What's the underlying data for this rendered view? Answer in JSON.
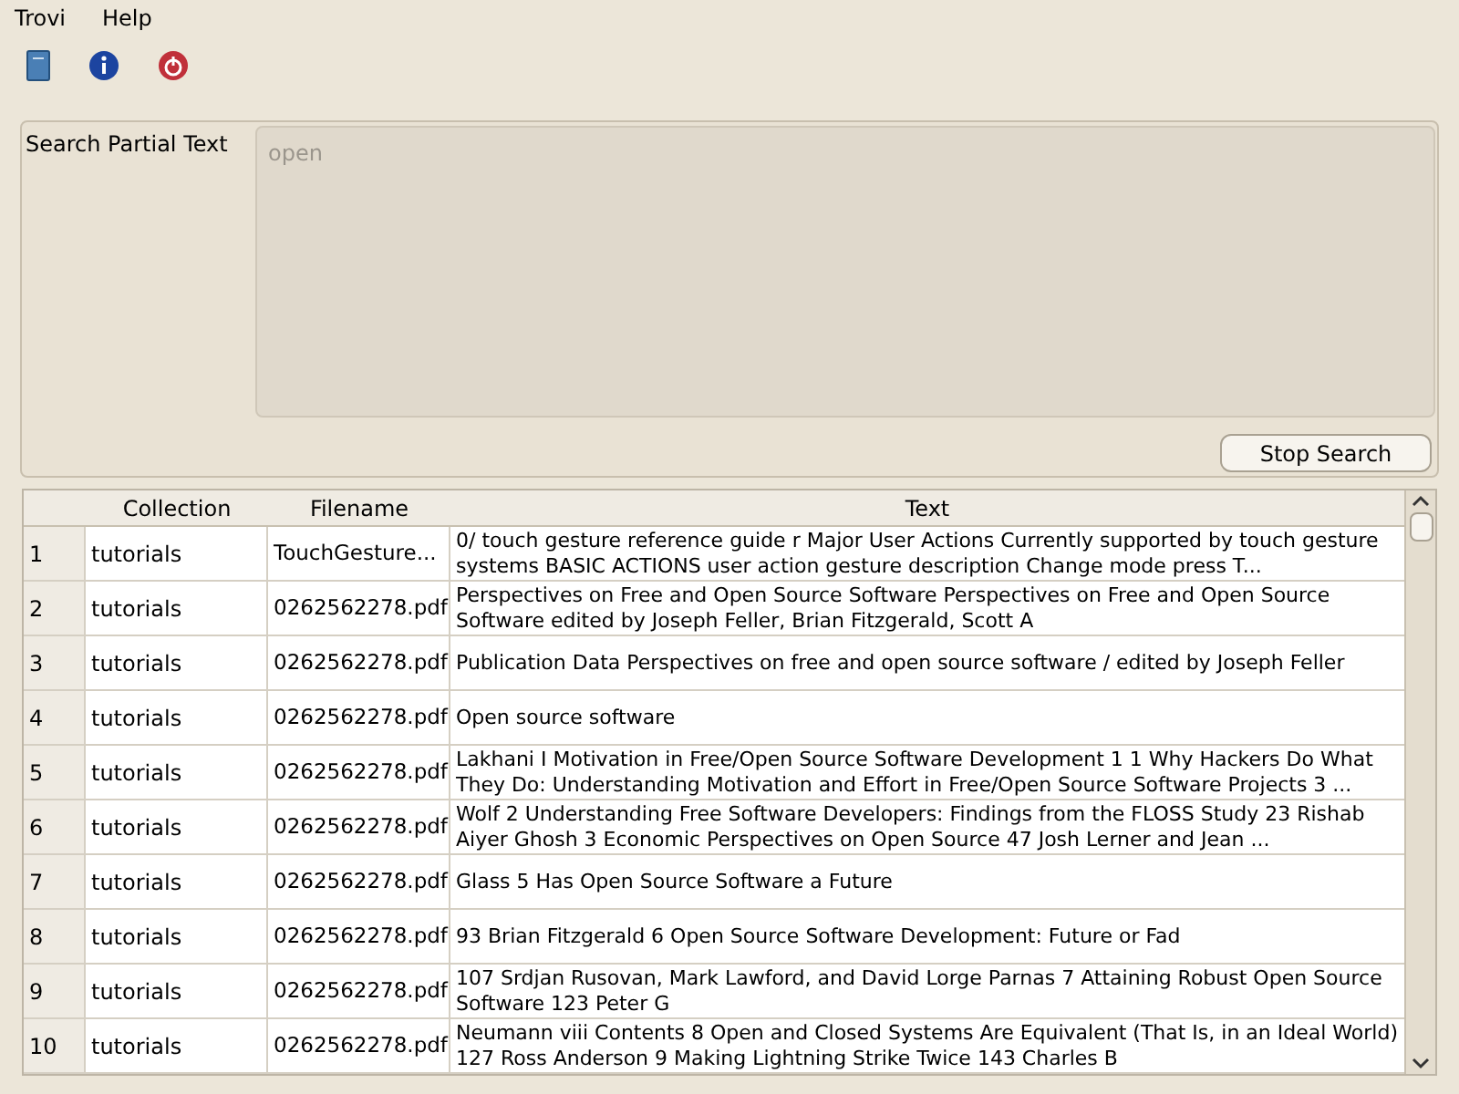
{
  "menu": [
    "Trovi",
    "Help"
  ],
  "search": {
    "label": "Search Partial Text",
    "value": "open",
    "disabled": true,
    "button": "Stop Search"
  },
  "table": {
    "columns": [
      "Collection",
      "Filename",
      "Text"
    ],
    "rows": [
      {
        "index": "1",
        "collection": "tutorials",
        "filename": "TouchGesture...",
        "text": "0/ touch gesture reference guide r Major User Actions Currently supported by touch gesture systems BASIC ACTIONS user action gesture description Change mode press T..."
      },
      {
        "index": "2",
        "collection": "tutorials",
        "filename": "0262562278.pdf",
        "text": "Perspectives on Free and Open Source Software Perspectives on Free and Open Source Software edited by Joseph Feller, Brian Fitzgerald, Scott A"
      },
      {
        "index": "3",
        "collection": "tutorials",
        "filename": "0262562278.pdf",
        "text": "Publication Data Perspectives on free and open source software / edited by Joseph Feller"
      },
      {
        "index": "4",
        "collection": "tutorials",
        "filename": "0262562278.pdf",
        "text": "Open source software"
      },
      {
        "index": "5",
        "collection": "tutorials",
        "filename": "0262562278.pdf",
        "text": "Lakhani I Motivation in Free/Open Source Software Development 1 1 Why Hackers Do What They Do: Understanding Motivation and Effort in Free/Open Source Software Projects 3 ..."
      },
      {
        "index": "6",
        "collection": "tutorials",
        "filename": "0262562278.pdf",
        "text": "Wolf 2 Understanding Free Software Developers: Findings from the FLOSS Study 23 Rishab Aiyer Ghosh 3 Economic Perspectives on Open Source 47 Josh Lerner and Jean ..."
      },
      {
        "index": "7",
        "collection": "tutorials",
        "filename": "0262562278.pdf",
        "text": "Glass 5 Has Open Source Software a Future"
      },
      {
        "index": "8",
        "collection": "tutorials",
        "filename": "0262562278.pdf",
        "text": "93 Brian Fitzgerald 6 Open Source Software Development: Future or Fad"
      },
      {
        "index": "9",
        "collection": "tutorials",
        "filename": "0262562278.pdf",
        "text": "107 Srdjan Rusovan, Mark Lawford, and David Lorge Parnas 7 Attaining Robust Open Source Software 123 Peter G"
      },
      {
        "index": "10",
        "collection": "tutorials",
        "filename": "0262562278.pdf",
        "text": "Neumann viii Contents 8 Open and Closed Systems Are Equivalent (That Is, in an Ideal World) 127 Ross Anderson 9 Making Lightning Strike Twice 143 Charles B"
      }
    ]
  }
}
